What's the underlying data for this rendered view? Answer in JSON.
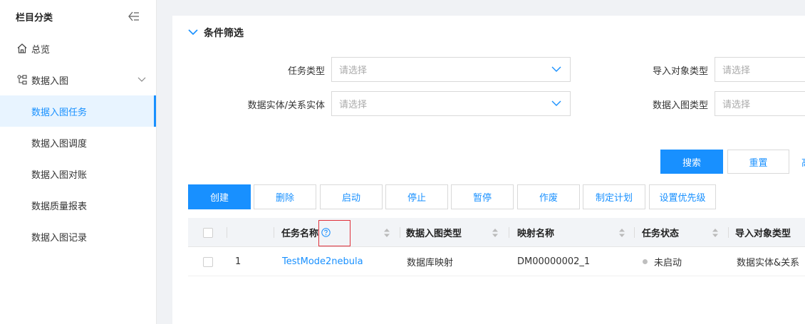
{
  "sidebar": {
    "title": "栏目分类",
    "items": [
      {
        "label": "总览",
        "icon": "home-icon"
      },
      {
        "label": "数据入图",
        "icon": "graph-icon"
      }
    ],
    "sub_items": [
      {
        "label": "数据入图任务",
        "active": true
      },
      {
        "label": "数据入图调度"
      },
      {
        "label": "数据入图对账"
      },
      {
        "label": "数据质量报表"
      },
      {
        "label": "数据入图记录"
      }
    ]
  },
  "filter": {
    "title": "条件筛选",
    "fields": [
      {
        "label": "任务类型",
        "placeholder": "请选择"
      },
      {
        "label": "导入对象类型",
        "placeholder": "请选择"
      },
      {
        "label": "数据实体/关系实体",
        "placeholder": "请选择"
      },
      {
        "label": "数据入图类型",
        "placeholder": "请选择"
      }
    ],
    "search_label": "搜索",
    "reset_label": "重置",
    "more_label": "高"
  },
  "toolbar": {
    "create": "创建",
    "delete": "删除",
    "start": "启动",
    "stop": "停止",
    "pause": "暂停",
    "void": "作废",
    "plan": "制定计划",
    "priority": "设置优先级"
  },
  "table": {
    "columns": [
      "任务名称",
      "数据入图类型",
      "映射名称",
      "任务状态",
      "导入对象类型"
    ],
    "rows": [
      {
        "index": "1",
        "name": "TestMode2nebula",
        "type": "数据库映射",
        "mapping": "DM00000002_1",
        "status": "未启动",
        "object_type": "数据实体&关系"
      }
    ]
  },
  "colors": {
    "accent": "#1890ff",
    "highlight": "#e0303a"
  }
}
